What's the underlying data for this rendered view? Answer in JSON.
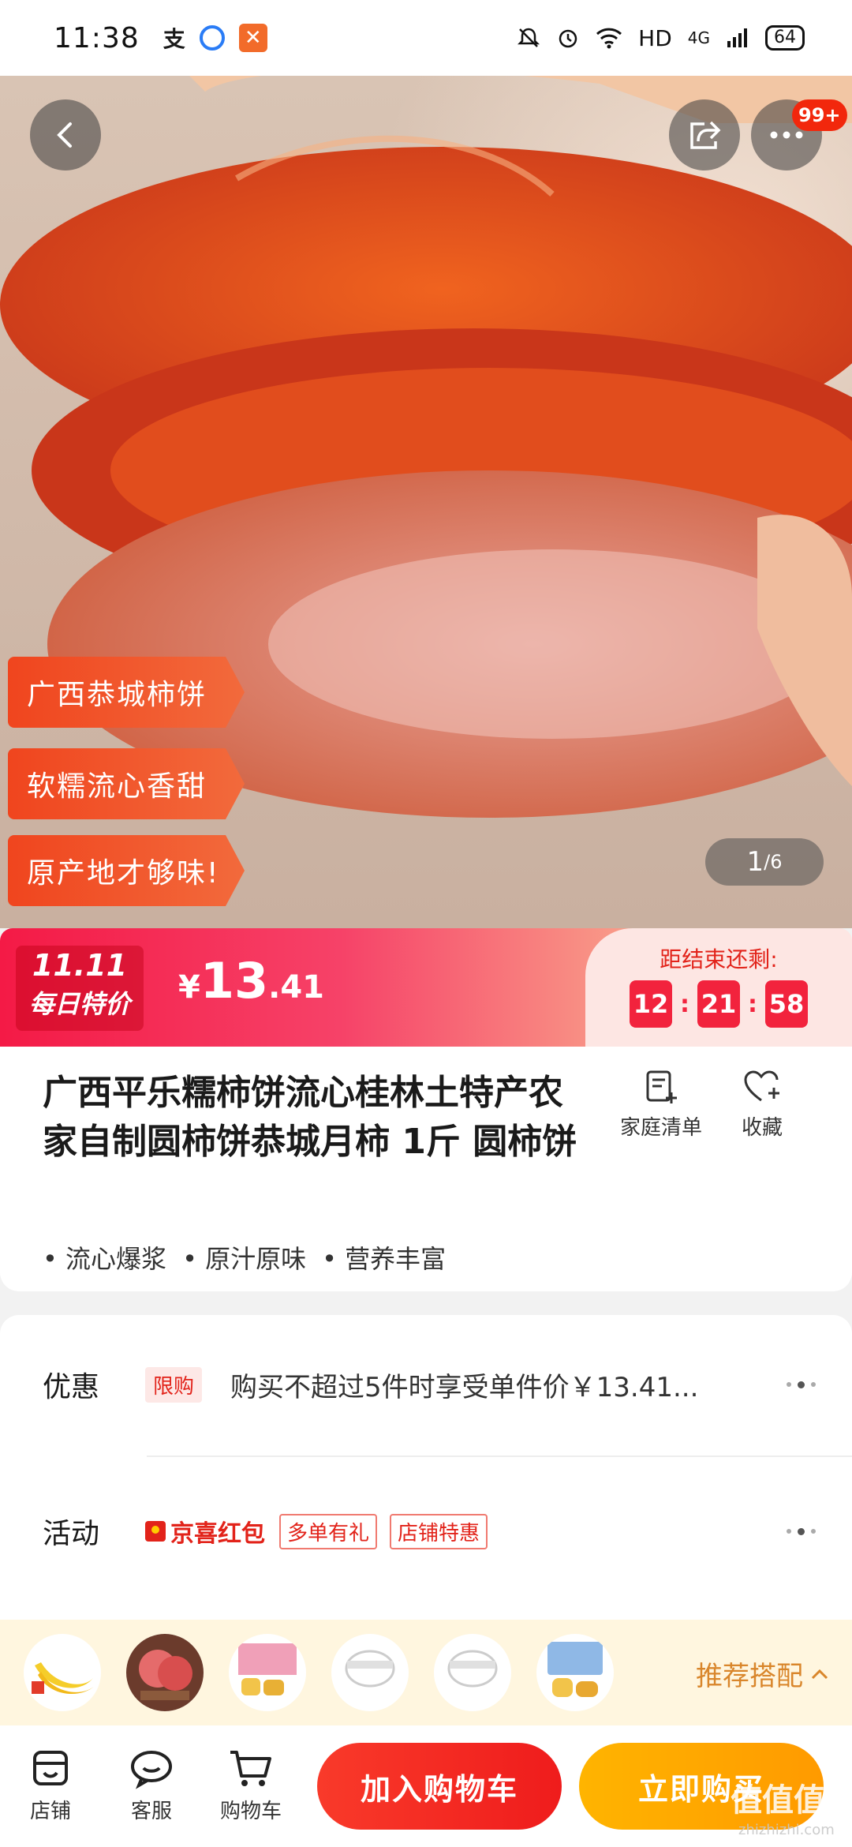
{
  "status_bar": {
    "time": "11:38",
    "network": "HD",
    "signal": "4G",
    "battery": "64",
    "icons": [
      "alipay-app-icon",
      "browser-app-icon",
      "app-icon",
      "mute-icon",
      "alarm-icon",
      "wifi-icon",
      "signal-icon"
    ]
  },
  "hero": {
    "notification_count": "99+",
    "tags": [
      "广西恭城柿饼",
      "软糯流心香甜",
      "原产地才够味!"
    ],
    "pager_current": "1",
    "pager_total": "/6"
  },
  "price_bar": {
    "promo_line1": "11.11",
    "promo_line2": "每日特价",
    "currency": "¥",
    "price_int": "13",
    "price_dec": ".41",
    "countdown_label": "距结束还剩:",
    "hours": "12",
    "minutes": "21",
    "seconds": "58",
    "colors": {
      "start": "#f41a46",
      "end": "#fde3da"
    }
  },
  "product": {
    "title": "广西平乐糯柿饼流心桂林土特产农家自制圆柿饼恭城月柿 1斤 圆柿饼",
    "actions": {
      "list": "家庭清单",
      "favorite": "收藏"
    },
    "features": [
      "• 流心爆浆",
      "• 原汁原味",
      "• 营养丰富"
    ]
  },
  "offers": {
    "discount_label": "优惠",
    "limit_tag": "限购",
    "discount_text": "购买不超过5件时享受单件价￥13.41...",
    "activity_label": "活动",
    "jx_label": "京喜红包",
    "activity_tags": [
      "多单有礼",
      "店铺特惠"
    ]
  },
  "reco": {
    "label": "推荐搭配",
    "items": [
      "banana",
      "peach",
      "snack-box",
      "blank",
      "blank",
      "cookie-bag"
    ]
  },
  "bottom": {
    "shop": "店铺",
    "service": "客服",
    "cart": "购物车",
    "add_to_cart": "加入购物车",
    "buy_now": "立即购买"
  },
  "watermark": {
    "main": "值值值",
    "sub": "zhizhizhi.com"
  },
  "colors": {
    "accent_red": "#e2231a",
    "cta_red": "#f93a2a",
    "cta_orange": "#ffa800"
  }
}
